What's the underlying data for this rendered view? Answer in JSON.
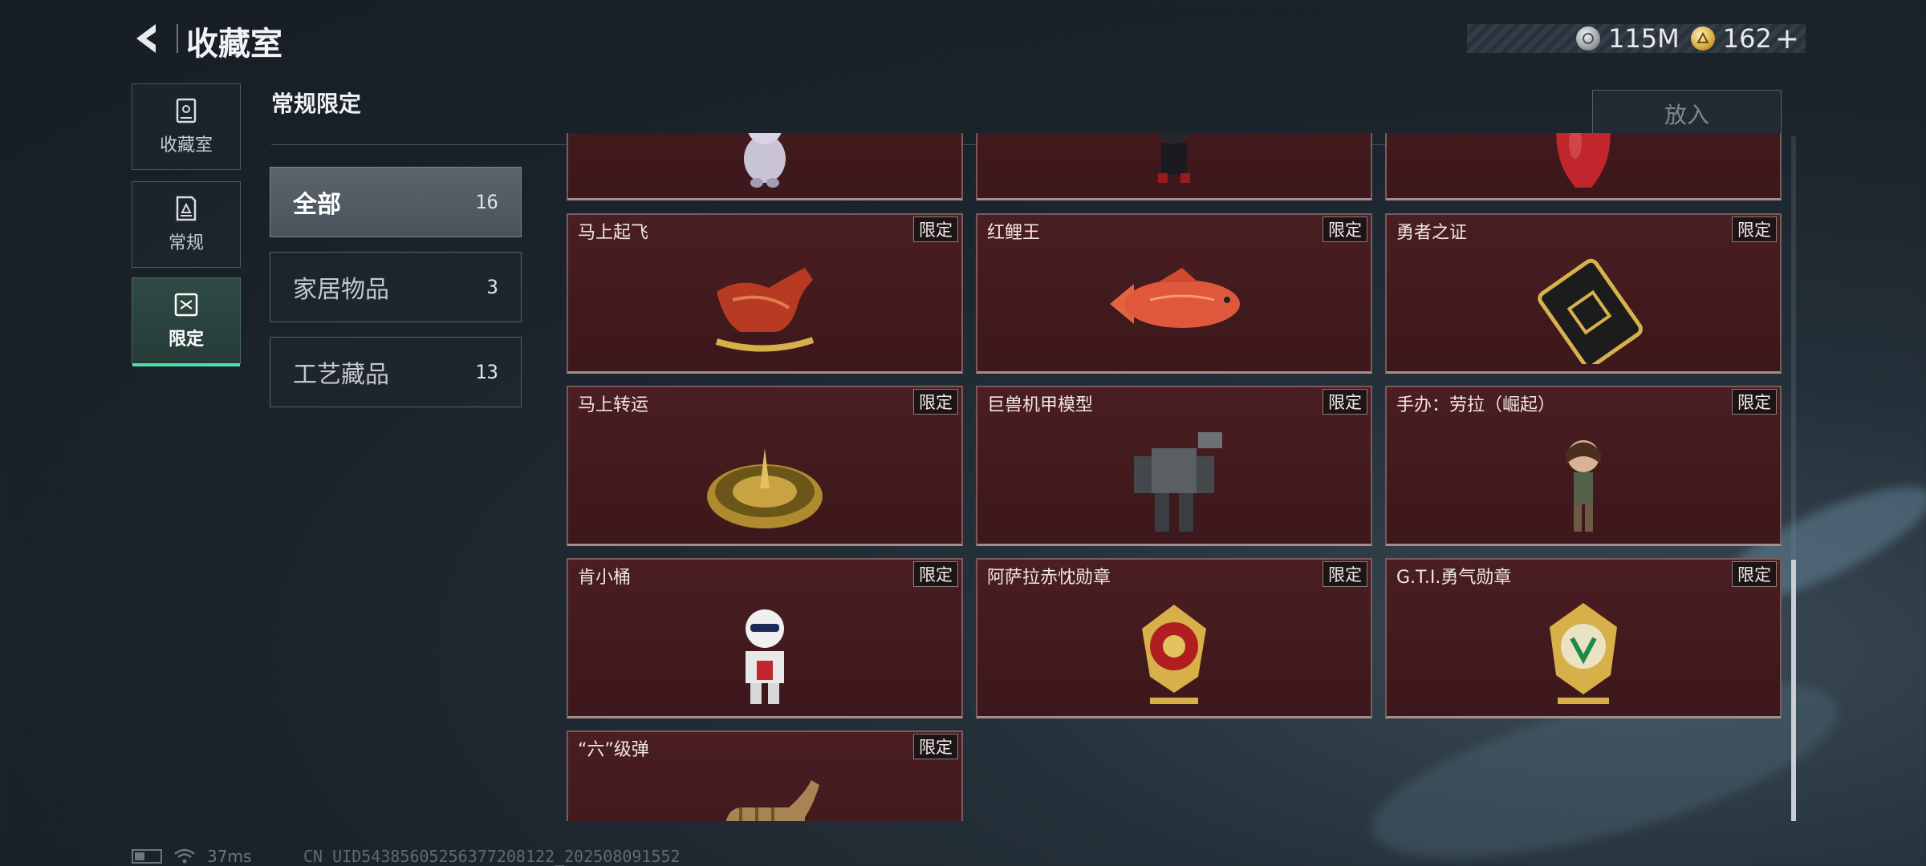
{
  "header": {
    "title": "收藏室",
    "currency_silver": "115M",
    "currency_gold": "162",
    "currency_gold_add": "+"
  },
  "nav": {
    "items": [
      {
        "label": "收藏室",
        "icon": "cabinet-icon"
      },
      {
        "label": "常规",
        "icon": "card-icon"
      },
      {
        "label": "限定",
        "icon": "limited-icon"
      }
    ]
  },
  "section": {
    "title": "常规限定",
    "put_label": "放入"
  },
  "categories": [
    {
      "name": "全部",
      "count": "16"
    },
    {
      "name": "家居物品",
      "count": "3"
    },
    {
      "name": "工艺藏品",
      "count": "13"
    }
  ],
  "tag_label": "限定",
  "cards": [
    {
      "name": "",
      "icon": "figurine-icon",
      "tag": ""
    },
    {
      "name": "",
      "icon": "robot-figure-icon",
      "tag": ""
    },
    {
      "name": "",
      "icon": "red-vase-icon",
      "tag": ""
    },
    {
      "name": "马上起飞",
      "icon": "horse-icon",
      "tag": "限定"
    },
    {
      "name": "红鲤王",
      "icon": "carp-icon",
      "tag": "限定"
    },
    {
      "name": "勇者之证",
      "icon": "card-badge-icon",
      "tag": "限定"
    },
    {
      "name": "马上转运",
      "icon": "spinner-disc-icon",
      "tag": "限定"
    },
    {
      "name": "巨兽机甲模型",
      "icon": "mech-icon",
      "tag": "限定"
    },
    {
      "name": "手办：劳拉（崛起）",
      "icon": "lara-figure-icon",
      "tag": "限定"
    },
    {
      "name": "肯小桶",
      "icon": "colonel-figure-icon",
      "tag": "限定"
    },
    {
      "name": "阿萨拉赤忱勋章",
      "icon": "red-medal-icon",
      "tag": "限定"
    },
    {
      "name": "G.T.I.勇气勋章",
      "icon": "green-medal-icon",
      "tag": "限定"
    },
    {
      "name": "“六”级弹",
      "icon": "hand-sign-icon",
      "tag": "限定"
    }
  ],
  "status": {
    "ping": "37ms",
    "uid": "CN UID543856052563772081​22_202508091552"
  },
  "colors": {
    "accent_green": "#4ee0a8",
    "card_bg": "#4a1e22"
  }
}
